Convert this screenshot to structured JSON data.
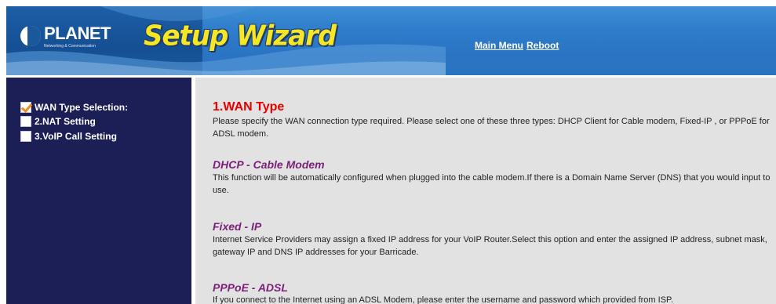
{
  "header": {
    "logo_text": "PLANET",
    "logo_tagline": "Networking & Communication",
    "title": "Setup Wizard",
    "links": {
      "main_menu": "Main Menu",
      "reboot": "Reboot"
    },
    "colors": {
      "title": "#f7e626",
      "banner": "#2e7ccb"
    }
  },
  "sidebar": {
    "items": [
      {
        "label": "WAN Type Selection:",
        "checked": true,
        "icon": "checked-box-icon"
      },
      {
        "label": "2.NAT Setting",
        "checked": false,
        "icon": "unchecked-box-icon"
      },
      {
        "label": "3.VoIP Call Setting",
        "checked": false,
        "icon": "unchecked-box-icon"
      }
    ],
    "colors": {
      "background": "#1c1f55",
      "check": "#f08a1c"
    }
  },
  "content": {
    "title": "1.WAN Type",
    "intro": "Please specify the WAN connection type required. Please select one of these three types: DHCP Client for Cable modem, Fixed-IP , or PPPoE for ADSL modem.",
    "sections": [
      {
        "title": "DHCP - Cable Modem",
        "text": "This function  will be automatically configured when plugged into the cable modem.If there is a Domain Name Server (DNS) that you would input to use."
      },
      {
        "title": "Fixed - IP",
        "text": "Internet Service Providers may assign a fixed IP address for your VoIP Router.Select this option and enter the assigned IP address, subnet mask, gateway IP and DNS IP addresses for your Barricade."
      },
      {
        "title": "PPPoE - ADSL",
        "text": "If you connect to the Internet using an ADSL Modem, please enter the username and password which provided from ISP."
      }
    ],
    "colors": {
      "title": "#e60000",
      "subtitle": "#7a1f78",
      "background": "#e2e2e2"
    }
  }
}
